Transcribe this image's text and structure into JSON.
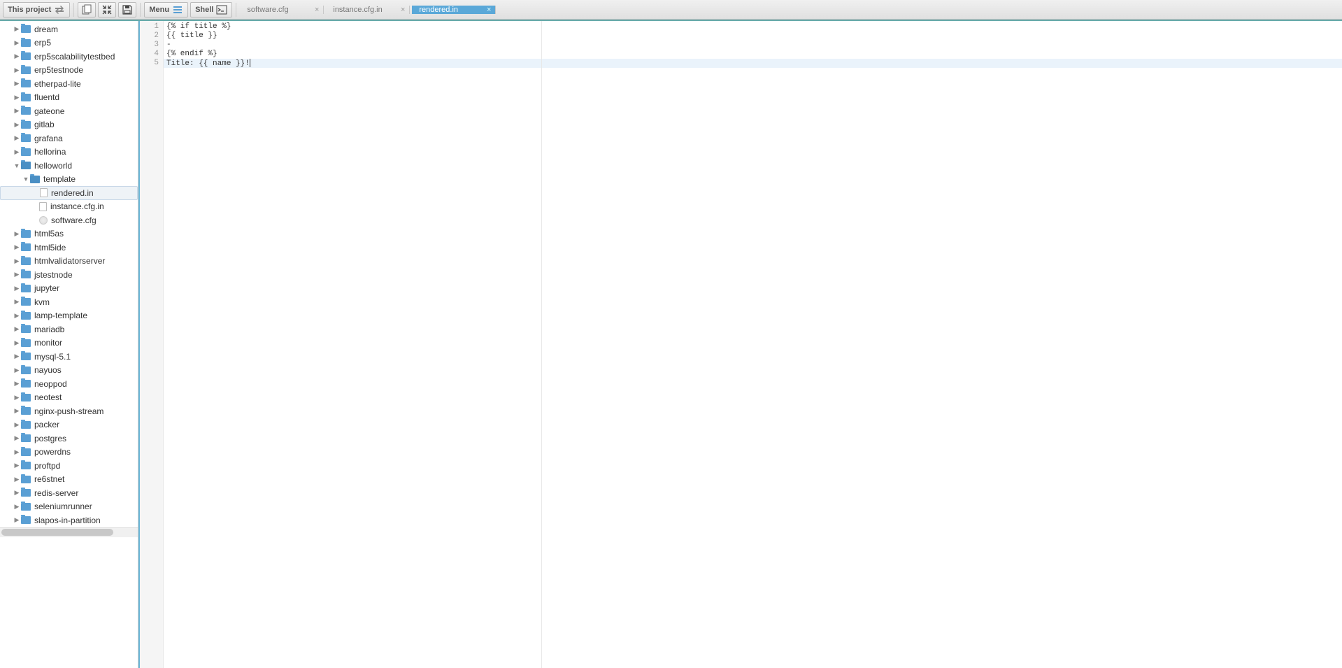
{
  "toolbar": {
    "project_label": "This project",
    "menu_label": "Menu",
    "shell_label": "Shell"
  },
  "tabs": [
    {
      "label": "software.cfg",
      "active": false
    },
    {
      "label": "instance.cfg.in",
      "active": false
    },
    {
      "label": "rendered.in",
      "active": true
    }
  ],
  "tree": {
    "top_folders": [
      "dream",
      "erp5",
      "erp5scalabilitytestbed",
      "erp5testnode",
      "etherpad-lite",
      "fluentd",
      "gateone",
      "gitlab",
      "grafana",
      "hellorina"
    ],
    "expanded_folder": "helloworld",
    "subfolder": "template",
    "sub_files": [
      {
        "name": "rendered.in",
        "type": "file",
        "selected": true
      },
      {
        "name": "instance.cfg.in",
        "type": "file",
        "selected": false
      },
      {
        "name": "software.cfg",
        "type": "cfg",
        "selected": false
      }
    ],
    "bottom_folders": [
      "html5as",
      "html5ide",
      "htmlvalidatorserver",
      "jstestnode",
      "jupyter",
      "kvm",
      "lamp-template",
      "mariadb",
      "monitor",
      "mysql-5.1",
      "nayuos",
      "neoppod",
      "neotest",
      "nginx-push-stream",
      "packer",
      "postgres",
      "powerdns",
      "proftpd",
      "re6stnet",
      "redis-server",
      "seleniumrunner",
      "slapos-in-partition"
    ]
  },
  "editor": {
    "lines": [
      "{% if title %}",
      "{{ title }}",
      "-",
      "{% endif %}",
      "Title: {{ name }}!"
    ],
    "current_line_index": 4
  }
}
